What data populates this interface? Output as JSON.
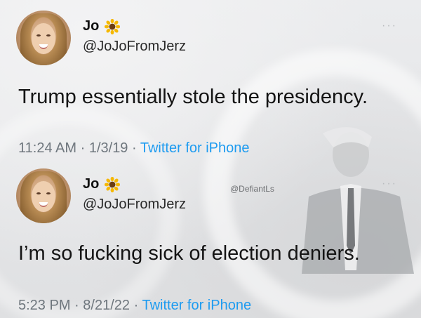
{
  "tweets": [
    {
      "display_name": "Jo",
      "emoji": "sunflower",
      "handle": "@JoJoFromJerz",
      "text": "Trump essentially stole the presidency.",
      "time": "11:24 AM",
      "date": "1/3/19",
      "source": "Twitter for iPhone",
      "more": "···"
    },
    {
      "display_name": "Jo",
      "emoji": "sunflower",
      "handle": "@JoJoFromJerz",
      "text": "I’m so fucking sick of election deniers.",
      "time": "5:23 PM",
      "date": "8/21/22",
      "source": "Twitter for iPhone",
      "more": "···"
    }
  ],
  "watermark": "@DefiantLs",
  "colors": {
    "link": "#1d9bf0",
    "meta": "#6e767d",
    "text": "#141414"
  }
}
